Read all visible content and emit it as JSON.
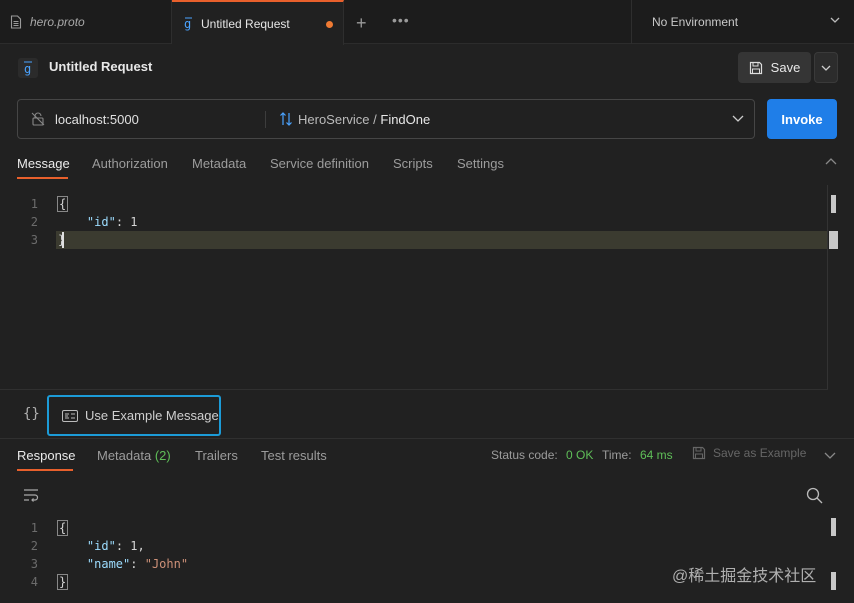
{
  "tabs": [
    {
      "label": "hero.proto",
      "icon": "file-icon"
    },
    {
      "label": "Untitled Request",
      "icon": "grpc-icon",
      "unsaved": true
    }
  ],
  "tabbar": {
    "new_tab": "+",
    "more": "•••"
  },
  "environment": {
    "selected": "No Environment"
  },
  "request": {
    "title": "Untitled Request",
    "save_label": "Save",
    "url": "localhost:5000",
    "service": "HeroService /",
    "method": "FindOne",
    "invoke_label": "Invoke"
  },
  "request_tabs": [
    "Message",
    "Authorization",
    "Metadata",
    "Service definition",
    "Scripts",
    "Settings"
  ],
  "message_editor": {
    "line_numbers": [
      "1",
      "2",
      "3"
    ],
    "lines": [
      "{",
      "    \"id\": 1",
      "}"
    ],
    "key": "\"id\"",
    "value": "1"
  },
  "example": {
    "braces": "{}",
    "label": "Use Example Message"
  },
  "response_tabs": {
    "response": "Response",
    "metadata": "Metadata",
    "metadata_count": "(2)",
    "trailers": "Trailers",
    "test_results": "Test results"
  },
  "status": {
    "label": "Status code:",
    "code": "0 OK",
    "time_label": "Time:",
    "time": "64 ms",
    "save_example": "Save as Example"
  },
  "response_editor": {
    "line_numbers": [
      "1",
      "2",
      "3",
      "4"
    ],
    "open": "{",
    "id_key": "\"id\"",
    "id_val": "1",
    "name_key": "\"name\"",
    "name_val": "\"John\"",
    "close": "}"
  },
  "watermark": "@稀土掘金技术社区",
  "colors": {
    "accent": "#e8602c",
    "invoke": "#1f7ee8",
    "ok": "#5fbf58",
    "highlight": "#1c9bd7"
  }
}
